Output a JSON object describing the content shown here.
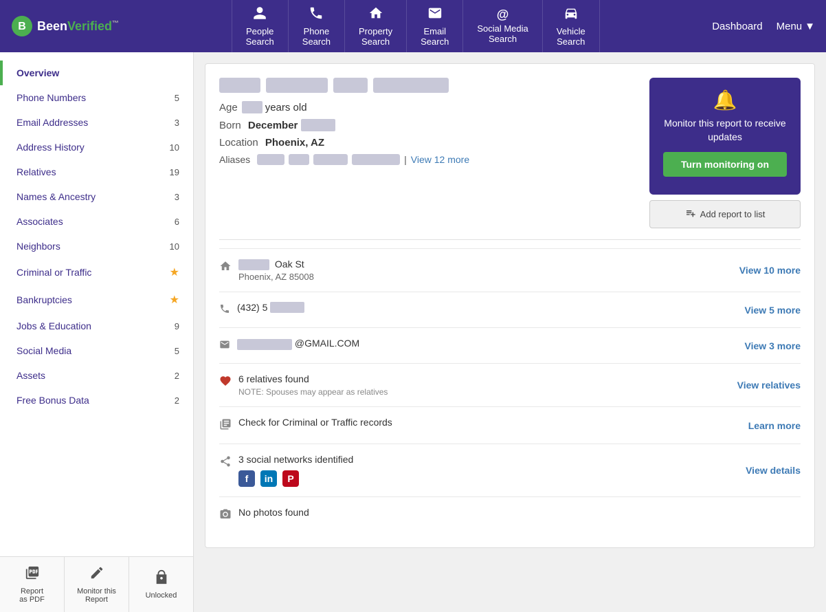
{
  "logo": {
    "text_been": "Been",
    "text_verified": "Verified",
    "tm": "™"
  },
  "nav": {
    "items": [
      {
        "id": "people",
        "icon": "👤",
        "line1": "People",
        "line2": "Search"
      },
      {
        "id": "phone",
        "icon": "📞",
        "line1": "Phone",
        "line2": "Search"
      },
      {
        "id": "property",
        "icon": "🏠",
        "line1": "Property",
        "line2": "Search"
      },
      {
        "id": "email",
        "icon": "✉️",
        "line1": "Email",
        "line2": "Search"
      },
      {
        "id": "social",
        "icon": "@",
        "line1": "Social Media",
        "line2": "Search"
      },
      {
        "id": "vehicle",
        "icon": "🚗",
        "line1": "Vehicle",
        "line2": "Search"
      }
    ]
  },
  "header_right": {
    "dashboard": "Dashboard",
    "menu": "Menu"
  },
  "sidebar": {
    "items": [
      {
        "id": "overview",
        "label": "Overview",
        "count": null,
        "active": true
      },
      {
        "id": "phone-numbers",
        "label": "Phone Numbers",
        "count": "5"
      },
      {
        "id": "email-addresses",
        "label": "Email Addresses",
        "count": "3"
      },
      {
        "id": "address-history",
        "label": "Address History",
        "count": "10"
      },
      {
        "id": "relatives",
        "label": "Relatives",
        "count": "19"
      },
      {
        "id": "names-ancestry",
        "label": "Names & Ancestry",
        "count": "3"
      },
      {
        "id": "associates",
        "label": "Associates",
        "count": "6"
      },
      {
        "id": "neighbors",
        "label": "Neighbors",
        "count": "10"
      },
      {
        "id": "criminal-traffic",
        "label": "Criminal or Traffic",
        "count": "star"
      },
      {
        "id": "bankruptcies",
        "label": "Bankruptcies",
        "count": "star"
      },
      {
        "id": "jobs-education",
        "label": "Jobs & Education",
        "count": "9"
      },
      {
        "id": "social-media",
        "label": "Social Media",
        "count": "5"
      },
      {
        "id": "assets",
        "label": "Assets",
        "count": "2"
      },
      {
        "id": "free-bonus",
        "label": "Free Bonus Data",
        "count": "2"
      }
    ],
    "footer": [
      {
        "id": "pdf",
        "icon": "📄",
        "label": "Report\nas PDF"
      },
      {
        "id": "monitor",
        "icon": "✏️",
        "label": "Monitor this\nReport"
      },
      {
        "id": "unlocked",
        "icon": "🔓",
        "label": "Unlocked"
      }
    ]
  },
  "person": {
    "age_label": "Age",
    "age_value": "years old",
    "born_label": "Born",
    "born_month": "December",
    "location_label": "Location",
    "location_value": "Phoenix, AZ",
    "aliases_label": "Aliases",
    "aliases_view_more": "View 12 more"
  },
  "monitor_box": {
    "title": "Monitor this report to receive updates",
    "button": "Turn monitoring on",
    "add_list": "Add report to list"
  },
  "sections": {
    "address": {
      "street": "Oak St",
      "city_state_zip": "Phoenix, AZ 85008",
      "view_more": "View 10 more"
    },
    "phone": {
      "number_prefix": "(432) 5",
      "view_more": "View 5 more"
    },
    "email": {
      "suffix": "@GMAIL.COM",
      "view_more": "View 3 more"
    },
    "relatives": {
      "count": "6 relatives found",
      "note": "NOTE: Spouses may appear as relatives",
      "view_link": "View relatives"
    },
    "criminal": {
      "label": "Check for Criminal or Traffic records",
      "view_link": "Learn more"
    },
    "social": {
      "count": "3 social networks identified",
      "view_link": "View details",
      "networks": [
        "Facebook",
        "LinkedIn",
        "Pinterest"
      ]
    },
    "photos": {
      "label": "No photos found"
    }
  }
}
